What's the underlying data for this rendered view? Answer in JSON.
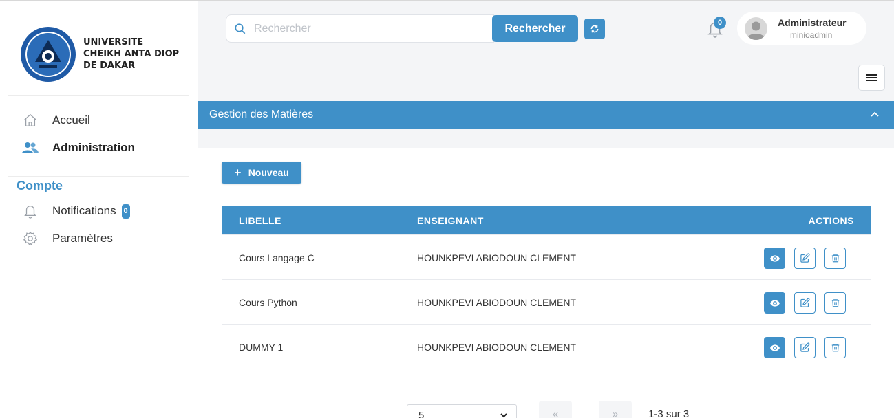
{
  "sidebar": {
    "university_name": [
      "UNIVERSITE",
      "CHEIKH ANTA DIOP",
      "DE DAKAR"
    ],
    "logo_text": "LUX · MEA · LEX",
    "nav": [
      {
        "label": "Accueil",
        "icon": "home-icon"
      },
      {
        "label": "Administration",
        "icon": "users-icon"
      }
    ],
    "section_title": "Compte",
    "account_nav": [
      {
        "label": "Notifications",
        "icon": "bell-icon",
        "badge": "0"
      },
      {
        "label": "Paramètres",
        "icon": "gear-icon"
      }
    ]
  },
  "header": {
    "search_placeholder": "Rechercher",
    "search_button": "Rechercher",
    "notification_count": "0",
    "user_name": "Administrateur",
    "user_login": "minioadmin"
  },
  "section": {
    "title": "Gestion des Matières"
  },
  "toolbar": {
    "new_label": "Nouveau"
  },
  "table": {
    "columns": [
      "LIBELLE",
      "ENSEIGNANT",
      "ACTIONS"
    ],
    "rows": [
      {
        "libelle": "Cours Langage C",
        "enseignant": "HOUNKPEVI ABIODOUN CLEMENT"
      },
      {
        "libelle": "Cours Python",
        "enseignant": "HOUNKPEVI ABIODOUN CLEMENT"
      },
      {
        "libelle": "DUMMY 1",
        "enseignant": "HOUNKPEVI ABIODOUN CLEMENT"
      }
    ]
  },
  "pagination": {
    "page_size": "5",
    "prev": "«",
    "next": "»",
    "info": "1-3 sur 3"
  },
  "colors": {
    "accent": "#3f90c8",
    "background": "#f4f5f7"
  }
}
